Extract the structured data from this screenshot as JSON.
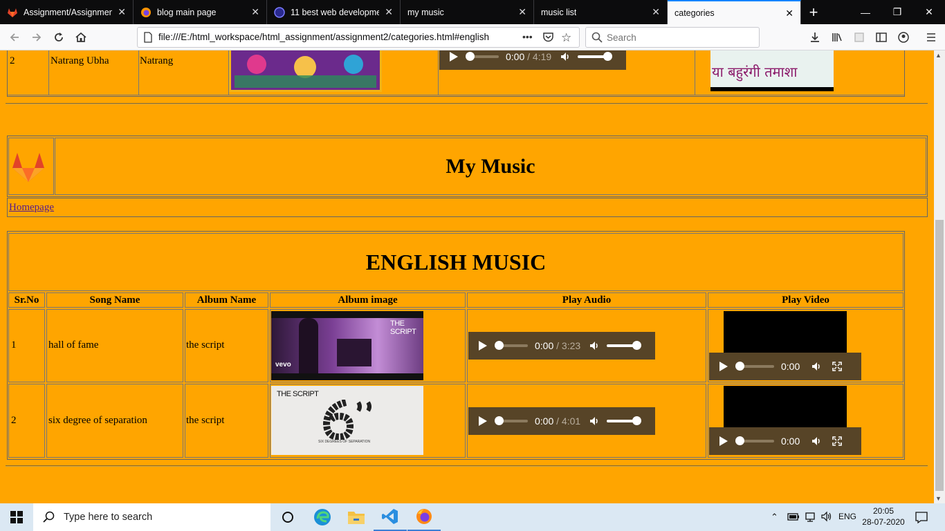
{
  "browser": {
    "tabs": [
      {
        "label": "Assignment/Assignment",
        "icon": "gitlab-icon",
        "active": false
      },
      {
        "label": "blog main page",
        "icon": "firefox-icon",
        "active": false
      },
      {
        "label": "11 best web developme",
        "icon": "site-icon",
        "active": false
      },
      {
        "label": "my music",
        "icon": "",
        "active": false
      },
      {
        "label": "music list",
        "icon": "",
        "active": false
      },
      {
        "label": "categories",
        "icon": "",
        "active": true
      }
    ],
    "new_tab": "+",
    "url": "file:///E:/html_workspace/html_assignment/assignment2/categories.html#english",
    "url_more": "•••",
    "search_placeholder": "Search"
  },
  "page": {
    "prev_section": {
      "sr_no": "2",
      "song_name": "Natrang Ubha",
      "album_name": "Natrang",
      "audio_time": "0:00",
      "audio_duration": "4:19",
      "poster_text": "या बहुरंगी तमाशा"
    },
    "header": {
      "title": "My Music",
      "homepage_link": "Homepage"
    },
    "english": {
      "title": "ENGLISH MUSIC",
      "columns": [
        "Sr.No",
        "Song Name",
        "Album Name",
        "Album image",
        "Play Audio",
        "Play Video"
      ],
      "rows": [
        {
          "sr_no": "1",
          "song_name": "hall of fame",
          "album_name": "the script",
          "album_text": "THE SCRIPT",
          "album_sub": "vevo",
          "audio_time": "0:00",
          "audio_duration": "3:23",
          "video_time": "0:00"
        },
        {
          "sr_no": "2",
          "song_name": "six degree of separation",
          "album_name": "the script",
          "album_text": "THE SCRIPT",
          "album_sub": "SIX DEGREES OF SEPARATION",
          "audio_time": "0:00",
          "audio_duration": "4:01",
          "video_time": "0:00"
        }
      ]
    }
  },
  "taskbar": {
    "search_placeholder": "Type here to search",
    "language": "ENG",
    "time": "20:05",
    "date": "28-07-2020"
  },
  "colors": {
    "page_bg": "#ffa500",
    "player_bg": "#574427",
    "tabbar_bg": "#0c0c0d"
  }
}
